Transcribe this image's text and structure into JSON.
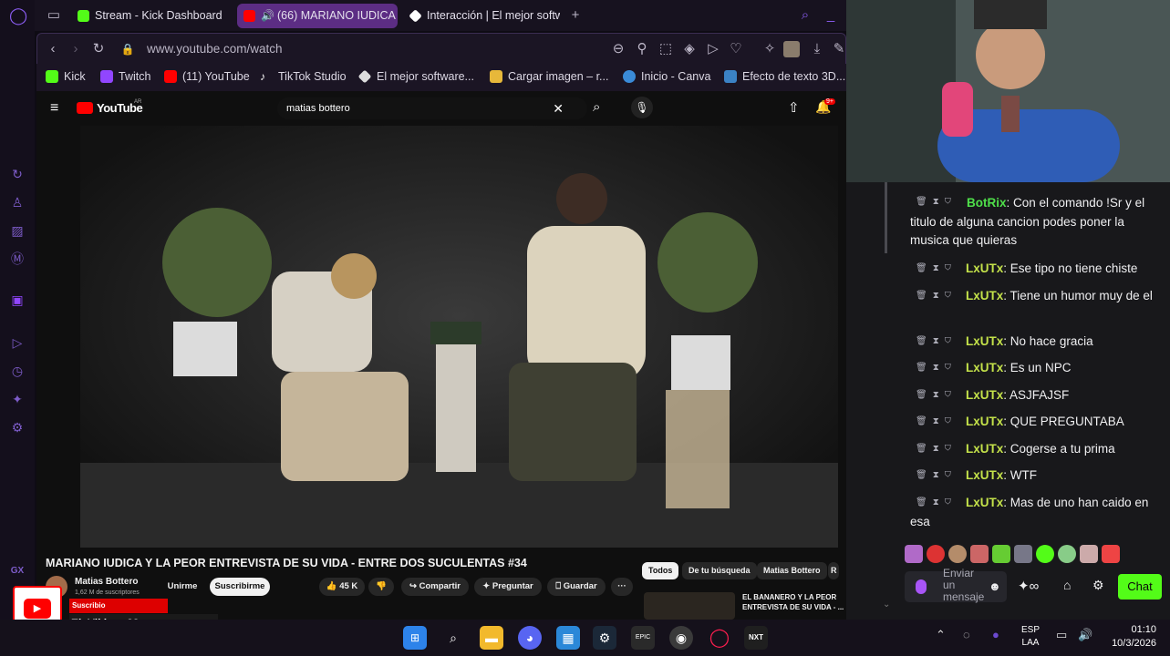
{
  "browser": {
    "tabs": [
      {
        "label": "Stream - Kick Dashboard",
        "favicon_color": "#53fc18"
      },
      {
        "label": "(66) MARIANO IUDICA",
        "favicon_color": "#ff0000"
      },
      {
        "label": "Interacción | El mejor softw",
        "favicon_color": "#ffffff"
      }
    ],
    "new_tab_label": "+",
    "url": "www.youtube.com/watch",
    "bookmarks": [
      {
        "label": "Kick",
        "color": "#53fc18"
      },
      {
        "label": "Twitch",
        "color": "#9146ff"
      },
      {
        "label": "(11) YouTube",
        "color": "#ff0000"
      },
      {
        "label": "TikTok Studio",
        "color": "#ffffff"
      },
      {
        "label": "El mejor software...",
        "color": "#dddddd"
      },
      {
        "label": "Cargar imagen – r...",
        "color": "#e7b83a"
      },
      {
        "label": "Inicio - Canva",
        "color": "#3a8bd8"
      },
      {
        "label": "Efecto de texto 3D...",
        "color": "#3b82c4"
      }
    ]
  },
  "youtube": {
    "logo_text": "YouTube",
    "logo_sup": "AR",
    "search_value": "matias bottero",
    "notif_count": "9+",
    "video_title": "MARIANO IUDICA Y LA PEOR ENTREVISTA DE SU VIDA - ENTRE DOS SUCULENTAS #34",
    "channel_name": "Matias Bottero",
    "subscribers": "1,62 M de suscriptores",
    "join_label": "Unirme",
    "subscribe_label": "Suscribirme",
    "likes": "45 K",
    "share_label": "Compartir",
    "ask_label": "Preguntar",
    "save_label": "Guardar",
    "more_label": "···",
    "chips": [
      "Todos",
      "De tu búsqueda",
      "Matias Bottero",
      "R"
    ],
    "next_video_title": "EL BANANERO Y LA PEOR ENTREVISTA DE SU VIDA - ..."
  },
  "chat": {
    "messages": [
      {
        "user": "BotRix",
        "text": "Con el comando !Sr y el titulo de alguna cancion podes poner la musica que quieras",
        "bot": true
      },
      {
        "user": "LxUTx",
        "text": "Ese tipo no tiene chiste"
      },
      {
        "user": "LxUTx",
        "text": "Tiene un humor muy de el"
      },
      {
        "user": "LxUTx",
        "text": "No hace gracia"
      },
      {
        "user": "LxUTx",
        "text": "Es un NPC"
      },
      {
        "user": "LxUTx",
        "text": "ASJFAJSF"
      },
      {
        "user": "LxUTx",
        "text": "QUE PREGUNTABA"
      },
      {
        "user": "LxUTx",
        "text": "Cogerse a tu prima"
      },
      {
        "user": "LxUTx",
        "text": "WTF"
      },
      {
        "user": "LxUTx",
        "text": "Mas de uno han caido en esa"
      }
    ],
    "input_placeholder": "Enviar un mensaje",
    "send_label": "Chat",
    "accent": "#53fc18"
  },
  "alert": {
    "label": "Suscribio",
    "user": "El_Vikingo23"
  },
  "taskbar": {
    "lang": "ESP",
    "lang_sub": "LAA",
    "time": "01:10",
    "date": "10/3/2026"
  },
  "sidebar": {
    "gx_label": "GX"
  }
}
